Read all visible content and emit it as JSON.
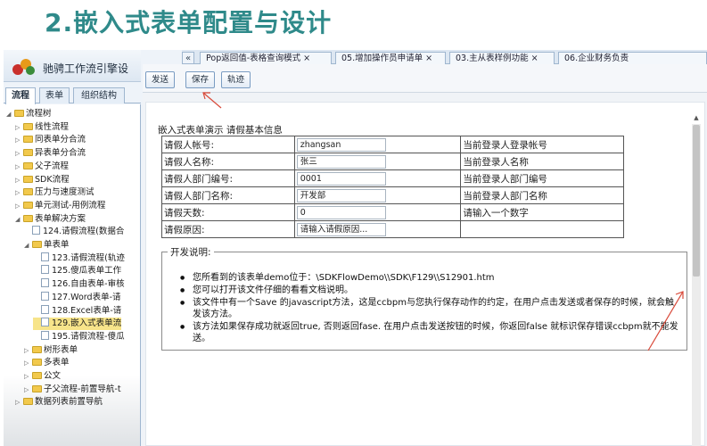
{
  "slide": {
    "title": "2.嵌入式表单配置与设计"
  },
  "app": {
    "title": "驰骋工作流引擎设",
    "left_tabs": [
      "流程",
      "表单",
      "组织结构"
    ],
    "tree": [
      {
        "label": "流程树",
        "toggle": "◢",
        "kind": "folder",
        "indent": 0
      },
      {
        "label": "线性流程",
        "toggle": "▷",
        "kind": "folder",
        "indent": 1
      },
      {
        "label": "同表单分合流",
        "toggle": "▷",
        "kind": "folder",
        "indent": 1
      },
      {
        "label": "异表单分合流",
        "toggle": "▷",
        "kind": "folder",
        "indent": 1
      },
      {
        "label": "父子流程",
        "toggle": "▷",
        "kind": "folder",
        "indent": 1
      },
      {
        "label": "SDK流程",
        "toggle": "▷",
        "kind": "folder",
        "indent": 1
      },
      {
        "label": "压力与速度测试",
        "toggle": "▷",
        "kind": "folder",
        "indent": 1
      },
      {
        "label": "单元测试-用例流程",
        "toggle": "▷",
        "kind": "folder",
        "indent": 1
      },
      {
        "label": "表单解决方案",
        "toggle": "◢",
        "kind": "folder",
        "indent": 1
      },
      {
        "label": "124.请假流程(数据合",
        "toggle": "",
        "kind": "file",
        "indent": 2
      },
      {
        "label": "单表单",
        "toggle": "◢",
        "kind": "folder",
        "indent": 2
      },
      {
        "label": "123.请假流程(轨迹",
        "toggle": "",
        "kind": "file",
        "indent": 3
      },
      {
        "label": "125.傻瓜表单工作",
        "toggle": "",
        "kind": "file",
        "indent": 3
      },
      {
        "label": "126.自由表单-审核",
        "toggle": "",
        "kind": "file",
        "indent": 3
      },
      {
        "label": "127.Word表单-请",
        "toggle": "",
        "kind": "file",
        "indent": 3
      },
      {
        "label": "128.Excel表单-请",
        "toggle": "",
        "kind": "file",
        "indent": 3
      },
      {
        "label": "129.嵌入式表单流",
        "toggle": "",
        "kind": "file",
        "indent": 3,
        "selected": true
      },
      {
        "label": "195.请假流程-傻瓜",
        "toggle": "",
        "kind": "file",
        "indent": 3
      },
      {
        "label": "树形表单",
        "toggle": "▷",
        "kind": "folder",
        "indent": 2
      },
      {
        "label": "多表单",
        "toggle": "▷",
        "kind": "folder",
        "indent": 2
      },
      {
        "label": "公文",
        "toggle": "▷",
        "kind": "folder",
        "indent": 2
      },
      {
        "label": "子父流程-前置导航-t",
        "toggle": "▷",
        "kind": "folder",
        "indent": 2
      },
      {
        "label": "数据列表前置导航",
        "toggle": "▷",
        "kind": "folder",
        "indent": 1
      }
    ],
    "doc_tabs": [
      {
        "label": "Pop返回值-表格查询模式 ×"
      },
      {
        "label": "05.增加操作员申请单 ×"
      },
      {
        "label": "03.主从表样例功能 ×"
      },
      {
        "label": "06.企业财务负责"
      }
    ],
    "tab_scroll_icon": "«"
  },
  "toolbar": {
    "send": "发送",
    "save": "保存",
    "track": "轨迹"
  },
  "form": {
    "title": "嵌入式表单演示   请假基本信息",
    "rows": [
      {
        "label": "请假人帐号:",
        "value": "zhangsan",
        "note": "当前登录人登录帐号"
      },
      {
        "label": "请假人名称:",
        "value": "张三",
        "note": "当前登录人名称"
      },
      {
        "label": "请假人部门编号:",
        "value": "0001",
        "note": "当前登录人部门编号"
      },
      {
        "label": "请假人部门名称:",
        "value": "开发部",
        "note": "当前登录人部门名称"
      },
      {
        "label": "请假天数:",
        "value": "0",
        "note": "请输入一个数字"
      },
      {
        "label": "请假原因:",
        "value": "请输入请假原因...",
        "note": ""
      }
    ]
  },
  "dev_notes": {
    "title": "开发说明:",
    "items": [
      "您所看到的该表单demo位于：\\SDKFlowDemo\\\\SDK\\F129\\\\S12901.htm",
      "您可以打开该文件仔细的看看文档说明。",
      "该文件中有一个Save 的javascript方法，这是ccbpm与您执行保存动作的约定，在用户点击发送或者保存的时候，就会触发该方法。",
      "该方法如果保存成功就返回true, 否则返回fase. 在用户点击发送按钮的时候，你返回false 就标识保存错误ccbpm就不能发送。"
    ]
  },
  "colors": {
    "title": "#2f8a8a",
    "annotation": "#d94a3a",
    "selected": "#f7e48a"
  },
  "icons": {
    "scroll_up": "▲"
  }
}
